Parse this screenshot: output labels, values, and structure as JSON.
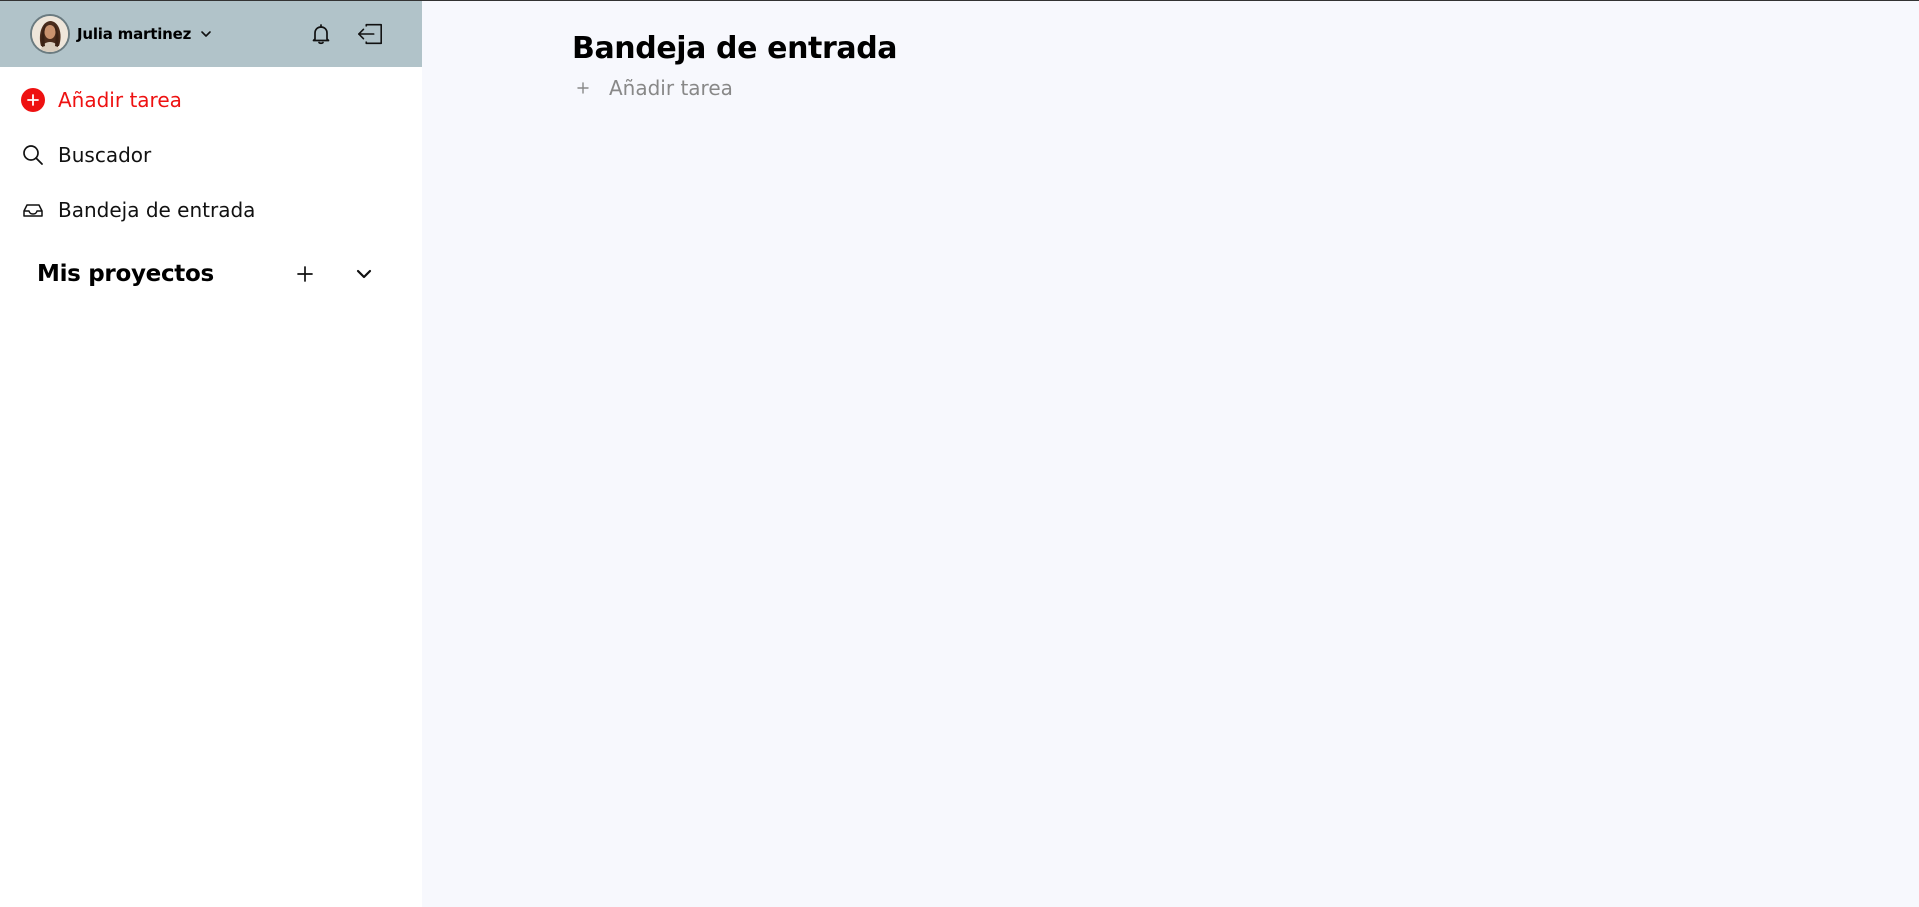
{
  "user": {
    "name": "Julia martinez"
  },
  "sidebar": {
    "items": [
      {
        "label": "Añadir tarea",
        "icon": "add-circle-icon"
      },
      {
        "label": "Buscador",
        "icon": "search-icon"
      },
      {
        "label": "Bandeja de entrada",
        "icon": "inbox-icon"
      }
    ],
    "projects": {
      "title": "Mis proyectos"
    }
  },
  "main": {
    "title": "Bandeja de entrada",
    "add_task_label": "Añadir tarea"
  },
  "colors": {
    "header_bg": "#b1c3c9",
    "accent_red": "#ee1111",
    "main_bg": "#f7f8fd"
  }
}
